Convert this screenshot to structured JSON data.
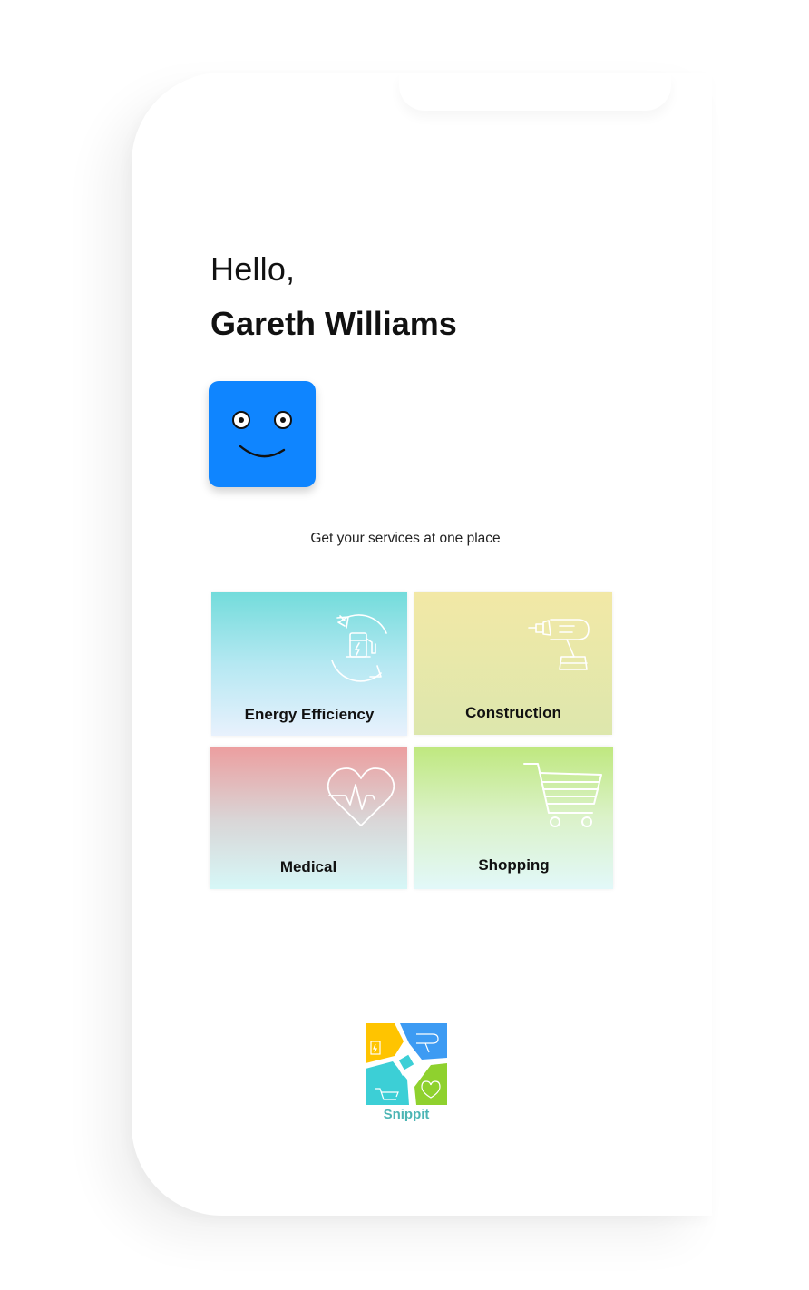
{
  "greeting": {
    "hello": "Hello,",
    "name": "Gareth Williams"
  },
  "avatar": {
    "icon": "smiley-face-icon",
    "color": "#0f85ff"
  },
  "tagline": "Get your services at one place",
  "services": [
    {
      "label": "Energy Efficiency",
      "icon": "ev-charging-station-icon"
    },
    {
      "label": "Construction",
      "icon": "power-drill-icon"
    },
    {
      "label": "Medical",
      "icon": "heartbeat-icon"
    },
    {
      "label": "Shopping",
      "icon": "shopping-cart-icon"
    }
  ],
  "brand": {
    "name": "Snippit",
    "logo_colors": [
      "#ffc400",
      "#3d9bf3",
      "#8fd12e",
      "#3ccfd6"
    ]
  }
}
